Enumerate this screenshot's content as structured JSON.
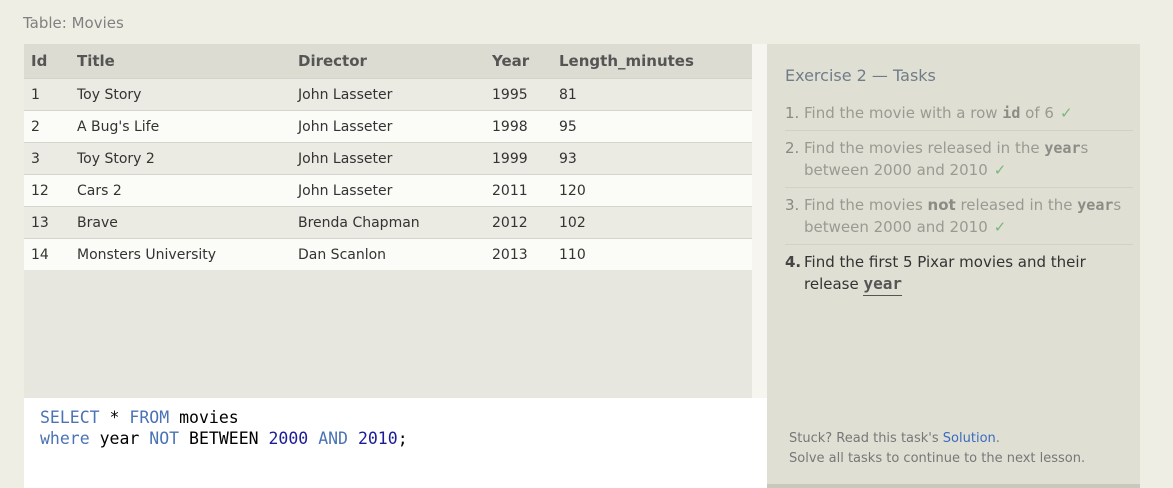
{
  "table_caption": "Table: Movies",
  "results": {
    "columns": [
      "Id",
      "Title",
      "Director",
      "Year",
      "Length_minutes"
    ],
    "rows": [
      [
        "1",
        "Toy Story",
        "John Lasseter",
        "1995",
        "81"
      ],
      [
        "2",
        "A Bug's Life",
        "John Lasseter",
        "1998",
        "95"
      ],
      [
        "3",
        "Toy Story 2",
        "John Lasseter",
        "1999",
        "93"
      ],
      [
        "12",
        "Cars 2",
        "John Lasseter",
        "2011",
        "120"
      ],
      [
        "13",
        "Brave",
        "Brenda Chapman",
        "2012",
        "102"
      ],
      [
        "14",
        "Monsters University",
        "Dan Scanlon",
        "2013",
        "110"
      ]
    ]
  },
  "editor": {
    "line1": {
      "kw1": "SELECT",
      "star": " * ",
      "kw2": "FROM",
      "rest": " movies"
    },
    "line2": {
      "kw1": "where",
      "t1": " year ",
      "kw2": "NOT",
      "t2": " BETWEEN ",
      "n1": "2000",
      "sp1": " ",
      "kw3": "AND",
      "sp2": " ",
      "n2": "2010",
      "end": ";"
    }
  },
  "sidebar": {
    "title": "Exercise 2 — Tasks",
    "tasks": [
      {
        "num": "1.",
        "parts": [
          "Find the movie with a row ",
          "id",
          " of 6"
        ],
        "check": "✓"
      },
      {
        "num": "2.",
        "parts": [
          "Find the movies released in the ",
          "year",
          "s between 2000 and 2010"
        ],
        "check": "✓"
      },
      {
        "num": "3.",
        "parts": [
          "Find the movies ",
          "not",
          " released in the ",
          "year",
          "s between 2000 and 2010"
        ],
        "check": "✓"
      },
      {
        "num": "4.",
        "parts": [
          "Find the first 5 Pixar movies and their release ",
          "year"
        ]
      }
    ],
    "stuck_text": "Stuck? Read this task's ",
    "solution_link": "Solution",
    "stuck_end": ".",
    "continue_text": "Solve all tasks to continue to the next lesson."
  },
  "colors": {
    "keyword": "#4a73b5",
    "number": "#1c1c9a",
    "check": "#7ab77a",
    "link": "#3a6bc0"
  }
}
